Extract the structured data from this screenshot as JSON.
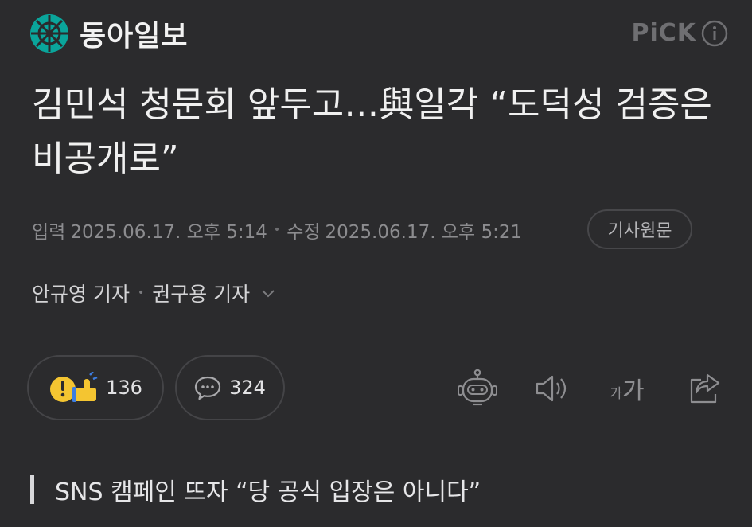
{
  "header": {
    "brand_name": "동아일보",
    "pick_label": "PiCK",
    "icons": {
      "logo": "dong-a-logo-icon",
      "info": "info-icon"
    }
  },
  "article": {
    "title": "김민석 청문회 앞두고…與일각 “도덕성 검증은 비공개로”",
    "meta": {
      "input_label": "입력",
      "input_time": "2025.06.17. 오후 5:14",
      "edit_label": "수정",
      "edit_time": "2025.06.17. 오후 5:21",
      "original_button": "기사원문"
    },
    "authors": [
      "안규영 기자",
      "권구용 기자"
    ],
    "reactions": {
      "count": "136",
      "icon": "reaction-emoji-icon"
    },
    "comments": {
      "count": "324",
      "icon": "comment-icon"
    },
    "toolbar_icons": [
      "robot-summary-icon",
      "speaker-icon",
      "font-size-icon",
      "share-icon"
    ],
    "font_size": {
      "small": "가",
      "big": "가"
    },
    "subheading": "SNS 캠페인 뜨자 “당 공식 입장은 아니다”"
  },
  "colors": {
    "background": "#2b2b2d",
    "logo_accent": "#0aa59b",
    "reaction_yellow": "#f4c531"
  }
}
